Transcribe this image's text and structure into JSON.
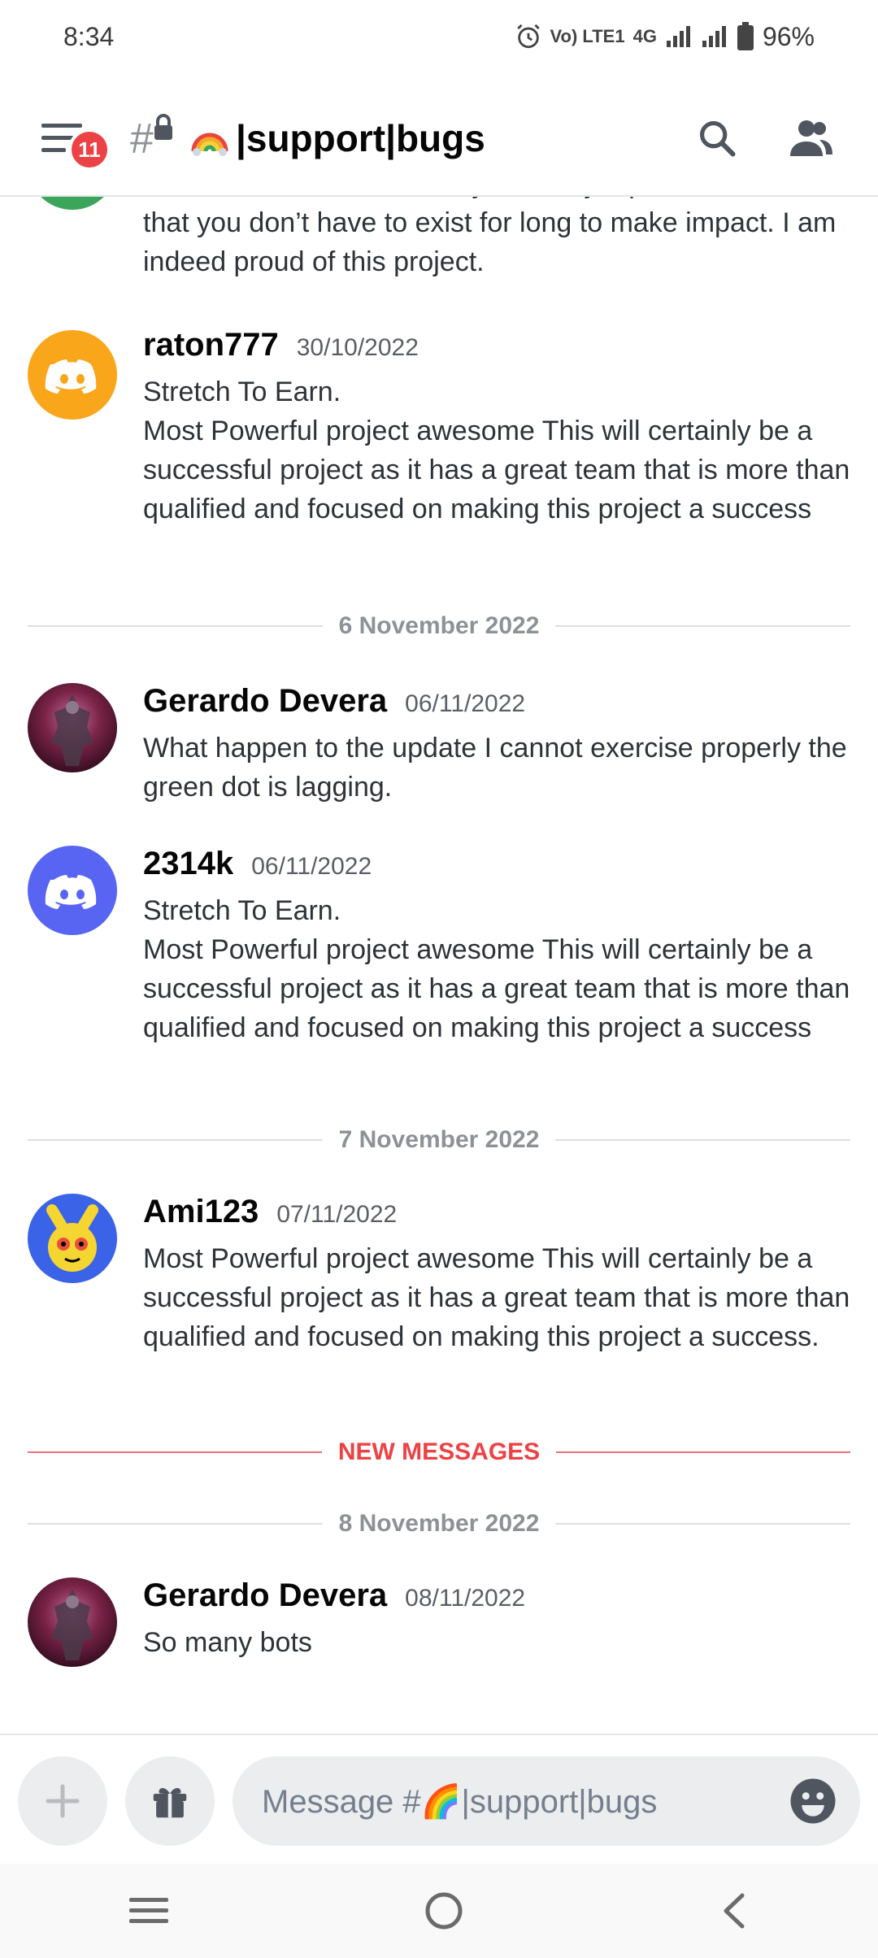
{
  "status_bar": {
    "time": "8:34",
    "network_small": "Vo) LTE1",
    "network_type": "4G",
    "battery": "96%"
  },
  "header": {
    "unread_badge": "11",
    "channel_name": "|support|bugs"
  },
  "messages": [
    {
      "text": "This feature is extraordinary and only a pointer to the fact that you don’t have to exist for long to make impact. I am indeed proud of this project."
    },
    {
      "user": "raton777",
      "time": "30/10/2022",
      "text_lines": [
        "Stretch To Earn.",
        "Most Powerful project awesome This will certainly be a successful project as it has a great team that is more than qualified and focused on making this project a success"
      ]
    },
    {
      "user": "Gerardo Devera",
      "time": "06/11/2022",
      "text": "What happen to the update I cannot exercise properly the green dot is lagging."
    },
    {
      "user": "2314k",
      "time": "06/11/2022",
      "text_lines": [
        "Stretch To Earn.",
        "Most Powerful project awesome This will certainly be a successful project as it has a great team that is more than qualified and focused on making this project a success"
      ]
    },
    {
      "user": "Ami123",
      "time": "07/11/2022",
      "text": "Most Powerful project awesome This will certainly be a successful project as it has a great team that is more than qualified and focused on making this project a success."
    },
    {
      "user": "Gerardo Devera",
      "time": "08/11/2022",
      "text": "So many bots"
    }
  ],
  "dividers": {
    "d1": "6 November 2022",
    "d2": "7 November 2022",
    "new_messages": "NEW MESSAGES",
    "d3": "8 November 2022"
  },
  "composer": {
    "placeholder": "Message #🌈|support|bugs"
  },
  "colors": {
    "blurple": "#5865f2",
    "orange": "#faa61a",
    "red": "#ed4245",
    "green": "#3ba55c"
  }
}
